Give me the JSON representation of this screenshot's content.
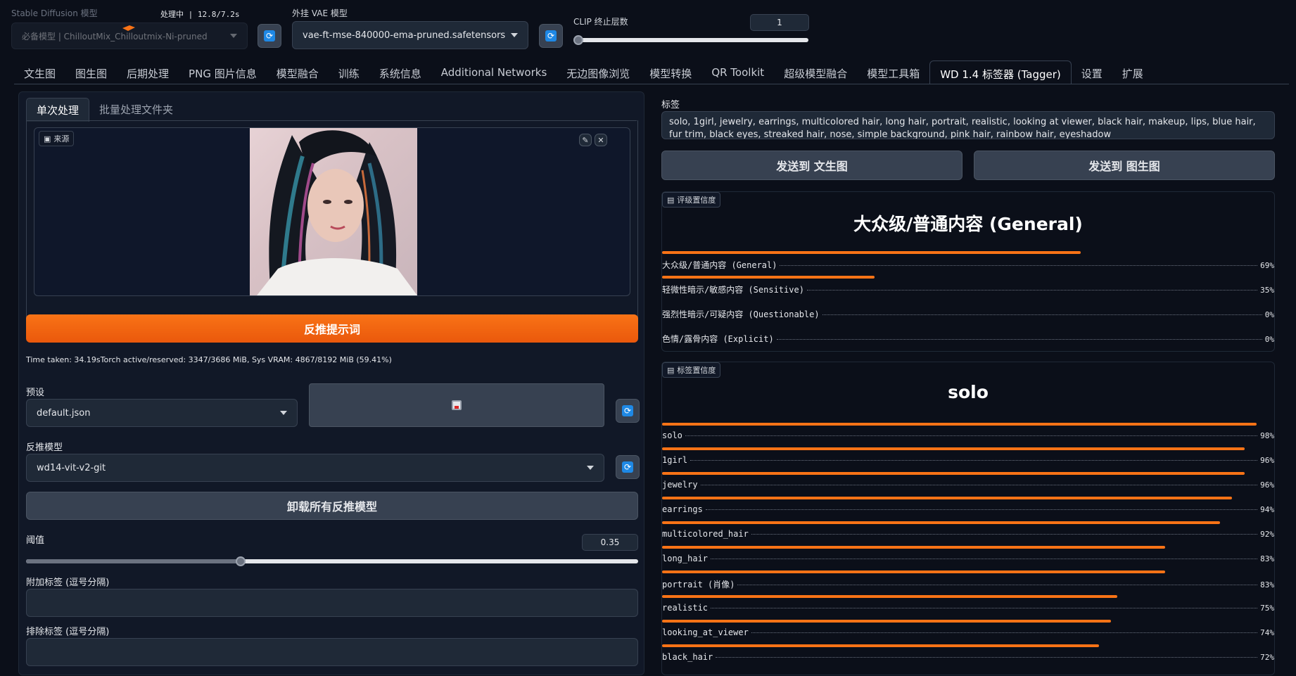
{
  "top": {
    "sd_model_label": "Stable Diffusion 模型",
    "status_text": "处理中 | 12.8/7.2s",
    "sd_model_value": "必备模型 | ChilloutMix_Chilloutmix-Ni-pruned",
    "vae_label": "外挂 VAE 模型",
    "vae_value": "vae-ft-mse-840000-ema-pruned.safetensors",
    "clip_label": "CLIP 终止层数",
    "clip_value": "1",
    "clip_slider_fraction": 0.0
  },
  "tabs": [
    "文生图",
    "图生图",
    "后期处理",
    "PNG 图片信息",
    "模型融合",
    "训练",
    "系统信息",
    "Additional Networks",
    "无边图像浏览",
    "模型转换",
    "QR Toolkit",
    "超级模型融合",
    "模型工具箱",
    "WD 1.4 标签器 (Tagger)",
    "设置",
    "扩展"
  ],
  "active_tab": "WD 1.4 标签器 (Tagger)",
  "left": {
    "subtabs": [
      "单次处理",
      "批量处理文件夹"
    ],
    "source_label": "来源",
    "interrogate_button": "反推提示词",
    "time_info": "Time taken: 34.19sTorch active/reserved: 3347/3686 MiB, Sys VRAM: 4867/8192 MiB (59.41%)",
    "preset_label": "预设",
    "preset_value": "default.json",
    "model_label": "反推模型",
    "model_value": "wd14-vit-v2-git",
    "unload_button": "卸载所有反推模型",
    "threshold_label": "阈值",
    "threshold_value": "0.35",
    "threshold_fraction": 0.35,
    "additional_tags_label": "附加标签 (逗号分隔)",
    "exclude_tags_label": "排除标签 (逗号分隔)"
  },
  "right": {
    "tags_label": "标签",
    "tags_text": "solo, 1girl, jewelry, earrings, multicolored hair, long hair, portrait, realistic, looking at viewer, black hair, makeup, lips, blue hair, fur trim, black eyes, streaked hair, nose, simple background, pink hair, rainbow hair, eyeshadow",
    "send_txt2img": "发送到 文生图",
    "send_img2img": "发送到 图生图",
    "rating_badge": "评级置信度",
    "rating_title": "大众级/普通内容 (General)",
    "ratings": [
      {
        "label": "大众级/普通内容 (General)",
        "pct": "69%",
        "value": 0.69
      },
      {
        "label": "轻微性暗示/敏感内容 (Sensitive)",
        "pct": "35%",
        "value": 0.35
      },
      {
        "label": "强烈性暗示/可疑内容 (Questionable)",
        "pct": "0%",
        "value": 0.0
      },
      {
        "label": "色情/露骨内容 (Explicit)",
        "pct": "0%",
        "value": 0.0
      }
    ],
    "tags_badge": "标签置信度",
    "tags_title": "solo",
    "tag_conf": [
      {
        "label": "solo",
        "pct": "98%",
        "value": 0.98
      },
      {
        "label": "1girl",
        "pct": "96%",
        "value": 0.96
      },
      {
        "label": "jewelry",
        "pct": "96%",
        "value": 0.96
      },
      {
        "label": "earrings",
        "pct": "94%",
        "value": 0.94
      },
      {
        "label": "multicolored_hair",
        "pct": "92%",
        "value": 0.92
      },
      {
        "label": "long_hair",
        "pct": "83%",
        "value": 0.83
      },
      {
        "label": "portrait (肖像)",
        "pct": "83%",
        "value": 0.83
      },
      {
        "label": "realistic",
        "pct": "75%",
        "value": 0.75
      },
      {
        "label": "looking_at_viewer",
        "pct": "74%",
        "value": 0.74
      },
      {
        "label": "black_hair",
        "pct": "72%",
        "value": 0.72
      }
    ]
  },
  "colors": {
    "accent": "#f97316",
    "bg": "#0b0f19",
    "panel": "#111827",
    "refresh": "#1e88e5"
  }
}
